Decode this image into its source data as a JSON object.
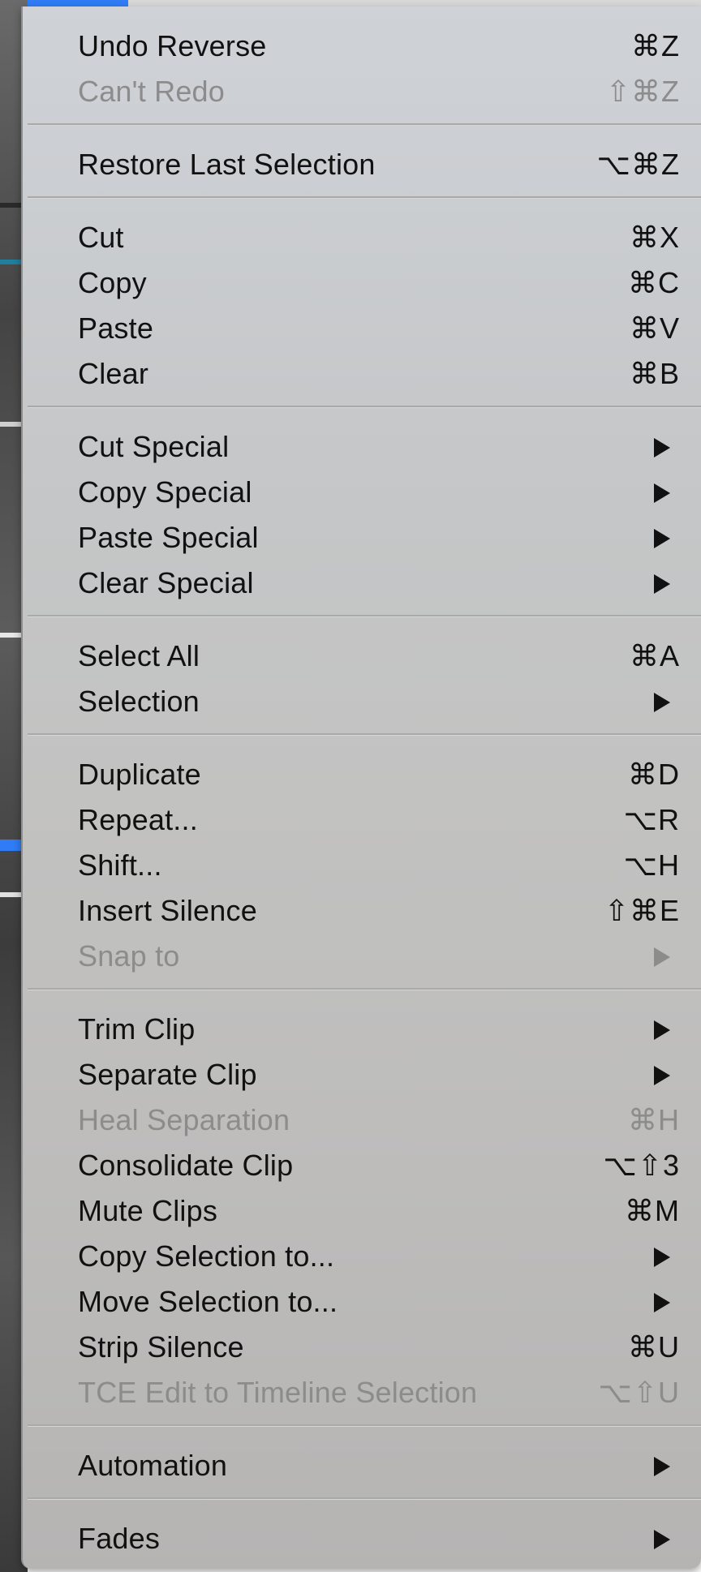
{
  "menu": {
    "groups": [
      {
        "items": [
          {
            "label": "Undo Reverse",
            "shortcut": "⌘Z",
            "submenu": false,
            "enabled": true,
            "icon": ""
          },
          {
            "label": "Can't Redo",
            "shortcut": "⇧⌘Z",
            "submenu": false,
            "enabled": false,
            "icon": ""
          }
        ]
      },
      {
        "items": [
          {
            "label": "Restore Last Selection",
            "shortcut": "⌥⌘Z",
            "submenu": false,
            "enabled": true,
            "icon": ""
          }
        ]
      },
      {
        "items": [
          {
            "label": "Cut",
            "shortcut": "⌘X",
            "submenu": false,
            "enabled": true,
            "icon": ""
          },
          {
            "label": "Copy",
            "shortcut": "⌘C",
            "submenu": false,
            "enabled": true,
            "icon": ""
          },
          {
            "label": "Paste",
            "shortcut": "⌘V",
            "submenu": false,
            "enabled": true,
            "icon": ""
          },
          {
            "label": "Clear",
            "shortcut": "⌘B",
            "submenu": false,
            "enabled": true,
            "icon": ""
          }
        ]
      },
      {
        "items": [
          {
            "label": "Cut Special",
            "shortcut": "",
            "submenu": true,
            "enabled": true,
            "icon": "chevron-right-icon"
          },
          {
            "label": "Copy Special",
            "shortcut": "",
            "submenu": true,
            "enabled": true,
            "icon": "chevron-right-icon"
          },
          {
            "label": "Paste Special",
            "shortcut": "",
            "submenu": true,
            "enabled": true,
            "icon": "chevron-right-icon"
          },
          {
            "label": "Clear Special",
            "shortcut": "",
            "submenu": true,
            "enabled": true,
            "icon": "chevron-right-icon"
          }
        ]
      },
      {
        "items": [
          {
            "label": "Select All",
            "shortcut": "⌘A",
            "submenu": false,
            "enabled": true,
            "icon": ""
          },
          {
            "label": "Selection",
            "shortcut": "",
            "submenu": true,
            "enabled": true,
            "icon": "chevron-right-icon"
          }
        ]
      },
      {
        "items": [
          {
            "label": "Duplicate",
            "shortcut": "⌘D",
            "submenu": false,
            "enabled": true,
            "icon": ""
          },
          {
            "label": "Repeat...",
            "shortcut": "⌥R",
            "submenu": false,
            "enabled": true,
            "icon": ""
          },
          {
            "label": "Shift...",
            "shortcut": "⌥H",
            "submenu": false,
            "enabled": true,
            "icon": ""
          },
          {
            "label": "Insert Silence",
            "shortcut": "⇧⌘E",
            "submenu": false,
            "enabled": true,
            "icon": ""
          },
          {
            "label": "Snap to",
            "shortcut": "",
            "submenu": true,
            "enabled": false,
            "icon": "chevron-right-icon"
          }
        ]
      },
      {
        "items": [
          {
            "label": "Trim Clip",
            "shortcut": "",
            "submenu": true,
            "enabled": true,
            "icon": "chevron-right-icon"
          },
          {
            "label": "Separate Clip",
            "shortcut": "",
            "submenu": true,
            "enabled": true,
            "icon": "chevron-right-icon"
          },
          {
            "label": "Heal Separation",
            "shortcut": "⌘H",
            "submenu": false,
            "enabled": false,
            "icon": ""
          },
          {
            "label": "Consolidate Clip",
            "shortcut": "⌥⇧3",
            "submenu": false,
            "enabled": true,
            "icon": ""
          },
          {
            "label": "Mute Clips",
            "shortcut": "⌘M",
            "submenu": false,
            "enabled": true,
            "icon": ""
          },
          {
            "label": "Copy Selection to...",
            "shortcut": "",
            "submenu": true,
            "enabled": true,
            "icon": "chevron-right-icon"
          },
          {
            "label": "Move Selection to...",
            "shortcut": "",
            "submenu": true,
            "enabled": true,
            "icon": "chevron-right-icon"
          },
          {
            "label": "Strip Silence",
            "shortcut": "⌘U",
            "submenu": false,
            "enabled": true,
            "icon": ""
          },
          {
            "label": "TCE Edit to Timeline Selection",
            "shortcut": "⌥⇧U",
            "submenu": false,
            "enabled": false,
            "icon": ""
          }
        ]
      },
      {
        "items": [
          {
            "label": "Automation",
            "shortcut": "",
            "submenu": true,
            "enabled": true,
            "icon": "chevron-right-icon"
          }
        ]
      },
      {
        "items": [
          {
            "label": "Fades",
            "shortcut": "",
            "submenu": true,
            "enabled": true,
            "icon": "chevron-right-icon"
          }
        ]
      }
    ]
  },
  "colors": {
    "accent": "#2f7cf6",
    "text": "#111111",
    "disabled_text": "#8c8c8c",
    "separator": "#a9a9a9"
  }
}
